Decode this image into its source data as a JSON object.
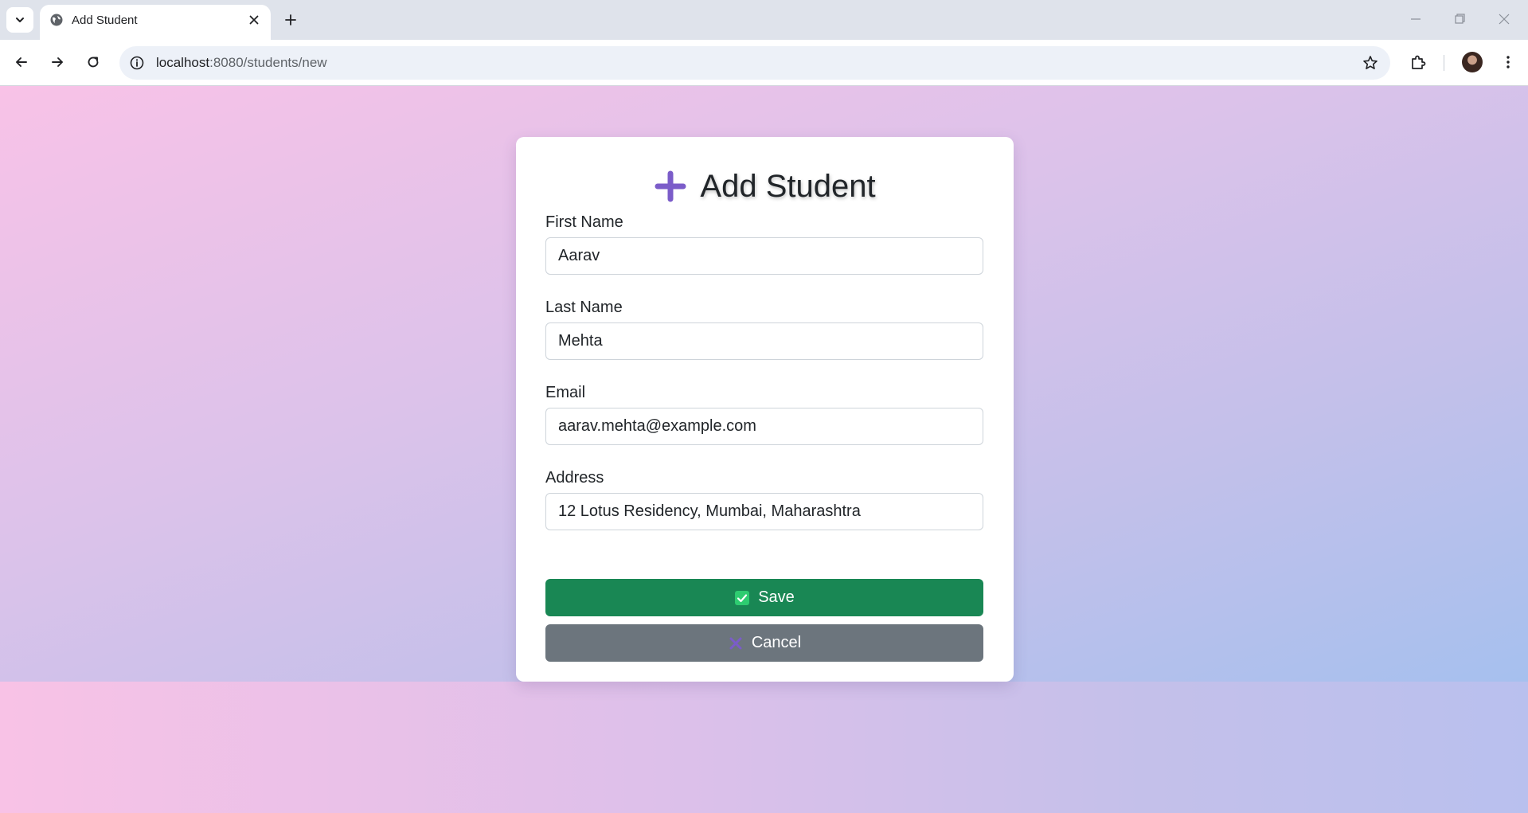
{
  "browser": {
    "tab": {
      "title": "Add Student"
    },
    "url": {
      "host": "localhost",
      "path": ":8080/students/new"
    }
  },
  "page": {
    "heading": "Add Student",
    "heading_icon": "plus-icon",
    "accent_color": "#7b5cc9",
    "fields": {
      "first_name": {
        "label": "First Name",
        "value": "Aarav"
      },
      "last_name": {
        "label": "Last Name",
        "value": "Mehta"
      },
      "email": {
        "label": "Email",
        "value": "aarav.mehta@example.com"
      },
      "address": {
        "label": "Address",
        "value": "12 Lotus Residency, Mumbai, Maharashtra"
      }
    },
    "buttons": {
      "save": {
        "label": "Save",
        "icon": "check-box-icon",
        "color": "#198754"
      },
      "cancel": {
        "label": "Cancel",
        "icon": "x-icon",
        "color": "#6c757d"
      }
    }
  }
}
